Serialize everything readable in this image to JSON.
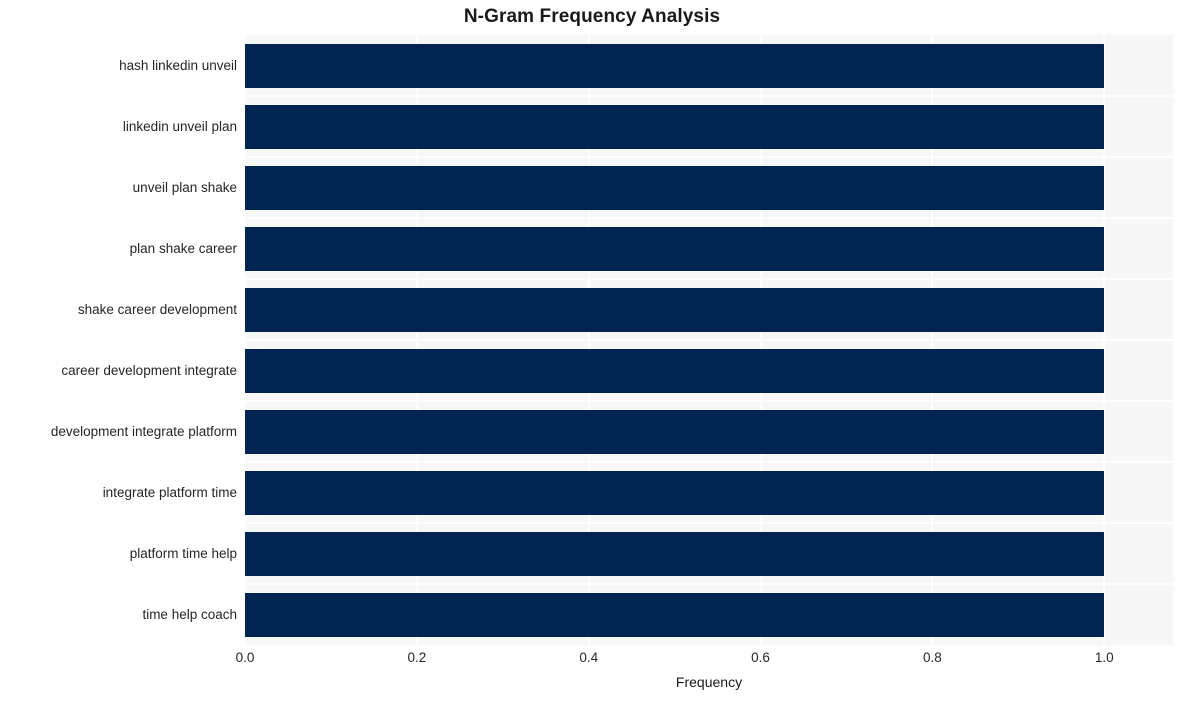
{
  "chart_data": {
    "type": "bar",
    "orientation": "horizontal",
    "title": "N-Gram Frequency Analysis",
    "xlabel": "Frequency",
    "ylabel": "",
    "categories": [
      "hash linkedin unveil",
      "linkedin unveil plan",
      "unveil plan shake",
      "plan shake career",
      "shake career development",
      "career development integrate",
      "development integrate platform",
      "integrate platform time",
      "platform time help",
      "time help coach"
    ],
    "values": [
      1.0,
      1.0,
      1.0,
      1.0,
      1.0,
      1.0,
      1.0,
      1.0,
      1.0,
      1.0
    ],
    "xlim": [
      0.0,
      1.08
    ],
    "xticks": [
      0.0,
      0.2,
      0.4,
      0.6,
      0.8,
      1.0
    ],
    "xticklabels": [
      "0.0",
      "0.2",
      "0.4",
      "0.6",
      "0.8",
      "1.0"
    ],
    "grid": true,
    "legend": null,
    "bar_color": "#022450",
    "plot_background": "#f7f7f7",
    "grid_color": "#ffffff",
    "text_color": "#262626"
  }
}
